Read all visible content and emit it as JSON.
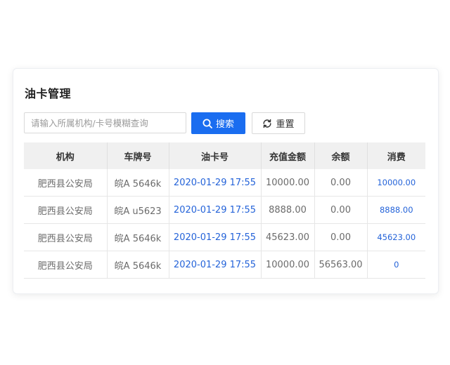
{
  "panel": {
    "title": "油卡管理",
    "search_placeholder": "请输入所属机构/卡号模糊查询",
    "search_button_label": "搜索",
    "reset_button_label": "重置"
  },
  "table": {
    "columns": [
      "机构",
      "车牌号",
      "油卡号",
      "充值金额",
      "余额",
      "消费"
    ],
    "rows": [
      {
        "org": "肥西县公安局",
        "plate": "皖A 5646k",
        "card": "2020-01-29 17:55",
        "recharge": "10000.00",
        "balance": "0.00",
        "spend": "10000.00"
      },
      {
        "org": "肥西县公安局",
        "plate": "皖A u5623",
        "card": "2020-01-29 17:55",
        "recharge": "8888.00",
        "balance": "0.00",
        "spend": "8888.00"
      },
      {
        "org": "肥西县公安局",
        "plate": "皖A 5646k",
        "card": "2020-01-29 17:55",
        "recharge": "45623.00",
        "balance": "0.00",
        "spend": "45623.00"
      },
      {
        "org": "肥西县公安局",
        "plate": "皖A 5646k",
        "card": "2020-01-29 17:55",
        "recharge": "10000.00",
        "balance": "56563.00",
        "spend": "0"
      }
    ]
  },
  "colors": {
    "primary": "#1a6df0",
    "link": "#2463d9",
    "header_bg": "#f0f0f0"
  },
  "icons": {
    "search": "search-icon",
    "reset": "refresh-icon"
  }
}
